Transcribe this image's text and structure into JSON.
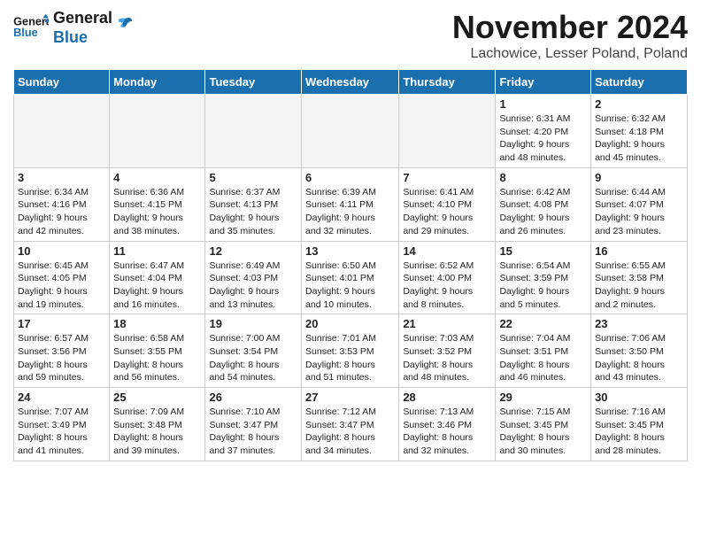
{
  "header": {
    "logo_general": "General",
    "logo_blue": "Blue",
    "month": "November 2024",
    "location": "Lachowice, Lesser Poland, Poland"
  },
  "days_of_week": [
    "Sunday",
    "Monday",
    "Tuesday",
    "Wednesday",
    "Thursday",
    "Friday",
    "Saturday"
  ],
  "weeks": [
    [
      {
        "day": "",
        "info": ""
      },
      {
        "day": "",
        "info": ""
      },
      {
        "day": "",
        "info": ""
      },
      {
        "day": "",
        "info": ""
      },
      {
        "day": "",
        "info": ""
      },
      {
        "day": "1",
        "info": "Sunrise: 6:31 AM\nSunset: 4:20 PM\nDaylight: 9 hours\nand 48 minutes."
      },
      {
        "day": "2",
        "info": "Sunrise: 6:32 AM\nSunset: 4:18 PM\nDaylight: 9 hours\nand 45 minutes."
      }
    ],
    [
      {
        "day": "3",
        "info": "Sunrise: 6:34 AM\nSunset: 4:16 PM\nDaylight: 9 hours\nand 42 minutes."
      },
      {
        "day": "4",
        "info": "Sunrise: 6:36 AM\nSunset: 4:15 PM\nDaylight: 9 hours\nand 38 minutes."
      },
      {
        "day": "5",
        "info": "Sunrise: 6:37 AM\nSunset: 4:13 PM\nDaylight: 9 hours\nand 35 minutes."
      },
      {
        "day": "6",
        "info": "Sunrise: 6:39 AM\nSunset: 4:11 PM\nDaylight: 9 hours\nand 32 minutes."
      },
      {
        "day": "7",
        "info": "Sunrise: 6:41 AM\nSunset: 4:10 PM\nDaylight: 9 hours\nand 29 minutes."
      },
      {
        "day": "8",
        "info": "Sunrise: 6:42 AM\nSunset: 4:08 PM\nDaylight: 9 hours\nand 26 minutes."
      },
      {
        "day": "9",
        "info": "Sunrise: 6:44 AM\nSunset: 4:07 PM\nDaylight: 9 hours\nand 23 minutes."
      }
    ],
    [
      {
        "day": "10",
        "info": "Sunrise: 6:45 AM\nSunset: 4:05 PM\nDaylight: 9 hours\nand 19 minutes."
      },
      {
        "day": "11",
        "info": "Sunrise: 6:47 AM\nSunset: 4:04 PM\nDaylight: 9 hours\nand 16 minutes."
      },
      {
        "day": "12",
        "info": "Sunrise: 6:49 AM\nSunset: 4:03 PM\nDaylight: 9 hours\nand 13 minutes."
      },
      {
        "day": "13",
        "info": "Sunrise: 6:50 AM\nSunset: 4:01 PM\nDaylight: 9 hours\nand 10 minutes."
      },
      {
        "day": "14",
        "info": "Sunrise: 6:52 AM\nSunset: 4:00 PM\nDaylight: 9 hours\nand 8 minutes."
      },
      {
        "day": "15",
        "info": "Sunrise: 6:54 AM\nSunset: 3:59 PM\nDaylight: 9 hours\nand 5 minutes."
      },
      {
        "day": "16",
        "info": "Sunrise: 6:55 AM\nSunset: 3:58 PM\nDaylight: 9 hours\nand 2 minutes."
      }
    ],
    [
      {
        "day": "17",
        "info": "Sunrise: 6:57 AM\nSunset: 3:56 PM\nDaylight: 8 hours\nand 59 minutes."
      },
      {
        "day": "18",
        "info": "Sunrise: 6:58 AM\nSunset: 3:55 PM\nDaylight: 8 hours\nand 56 minutes."
      },
      {
        "day": "19",
        "info": "Sunrise: 7:00 AM\nSunset: 3:54 PM\nDaylight: 8 hours\nand 54 minutes."
      },
      {
        "day": "20",
        "info": "Sunrise: 7:01 AM\nSunset: 3:53 PM\nDaylight: 8 hours\nand 51 minutes."
      },
      {
        "day": "21",
        "info": "Sunrise: 7:03 AM\nSunset: 3:52 PM\nDaylight: 8 hours\nand 48 minutes."
      },
      {
        "day": "22",
        "info": "Sunrise: 7:04 AM\nSunset: 3:51 PM\nDaylight: 8 hours\nand 46 minutes."
      },
      {
        "day": "23",
        "info": "Sunrise: 7:06 AM\nSunset: 3:50 PM\nDaylight: 8 hours\nand 43 minutes."
      }
    ],
    [
      {
        "day": "24",
        "info": "Sunrise: 7:07 AM\nSunset: 3:49 PM\nDaylight: 8 hours\nand 41 minutes."
      },
      {
        "day": "25",
        "info": "Sunrise: 7:09 AM\nSunset: 3:48 PM\nDaylight: 8 hours\nand 39 minutes."
      },
      {
        "day": "26",
        "info": "Sunrise: 7:10 AM\nSunset: 3:47 PM\nDaylight: 8 hours\nand 37 minutes."
      },
      {
        "day": "27",
        "info": "Sunrise: 7:12 AM\nSunset: 3:47 PM\nDaylight: 8 hours\nand 34 minutes."
      },
      {
        "day": "28",
        "info": "Sunrise: 7:13 AM\nSunset: 3:46 PM\nDaylight: 8 hours\nand 32 minutes."
      },
      {
        "day": "29",
        "info": "Sunrise: 7:15 AM\nSunset: 3:45 PM\nDaylight: 8 hours\nand 30 minutes."
      },
      {
        "day": "30",
        "info": "Sunrise: 7:16 AM\nSunset: 3:45 PM\nDaylight: 8 hours\nand 28 minutes."
      }
    ]
  ]
}
